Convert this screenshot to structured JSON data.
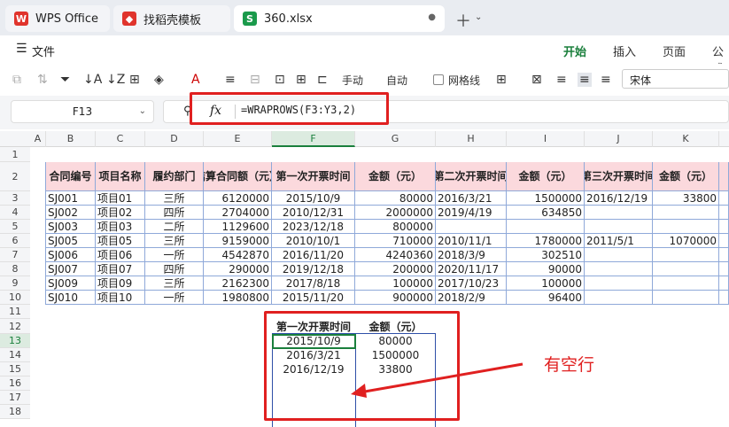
{
  "tabs": [
    {
      "label": "WPS Office",
      "icon": "wps-logo-icon"
    },
    {
      "label": "找稻壳模板",
      "icon": "docer-icon"
    },
    {
      "label": "360.xlsx",
      "icon": "spreadsheet-icon",
      "badge": "S"
    }
  ],
  "menu": {
    "file": "文件",
    "ribbon_tabs": [
      "开始",
      "插入",
      "页面",
      "公式"
    ]
  },
  "toolbar": {
    "manual": "手动",
    "auto": "自动",
    "gridlines": "网格线",
    "font": "宋体"
  },
  "formula_bar": {
    "cell_ref": "F13",
    "fx": "fx",
    "formula": "=WRAPROWS(F3:Y3,2)"
  },
  "columns": [
    "A",
    "B",
    "C",
    "D",
    "E",
    "F",
    "G",
    "H",
    "I",
    "J",
    "K"
  ],
  "rows": [
    "1",
    "2",
    "3",
    "4",
    "5",
    "6",
    "7",
    "8",
    "9",
    "10",
    "11",
    "12",
    "13",
    "14",
    "15",
    "16",
    "17",
    "18"
  ],
  "table_headers": [
    "合同编号",
    "项目名称",
    "履约部门",
    "结算合同额（元）",
    "第一次开票时间",
    "金额（元）",
    "第二次开票时间",
    "金额（元）",
    "第三次开票时间",
    "金额（元）"
  ],
  "table_rows": [
    [
      "SJ001",
      "项目01",
      "三所",
      "6120000",
      "2015/10/9",
      "80000",
      "2016/3/21",
      "1500000",
      "2016/12/19",
      "33800"
    ],
    [
      "SJ002",
      "项目02",
      "四所",
      "2704000",
      "2010/12/31",
      "2000000",
      "2019/4/19",
      "634850",
      "",
      ""
    ],
    [
      "SJ003",
      "项目03",
      "二所",
      "1129600",
      "2023/12/18",
      "800000",
      "",
      "",
      "",
      ""
    ],
    [
      "SJ005",
      "项目05",
      "三所",
      "9159000",
      "2010/10/1",
      "710000",
      "2010/11/1",
      "1780000",
      "2011/5/1",
      "1070000"
    ],
    [
      "SJ006",
      "项目06",
      "一所",
      "4542870",
      "2016/11/20",
      "4240360",
      "2018/3/9",
      "302510",
      "",
      ""
    ],
    [
      "SJ007",
      "项目07",
      "四所",
      "290000",
      "2019/12/18",
      "200000",
      "2020/11/17",
      "90000",
      "",
      ""
    ],
    [
      "SJ009",
      "项目09",
      "三所",
      "2162300",
      "2017/8/18",
      "100000",
      "2017/10/23",
      "100000",
      "",
      ""
    ],
    [
      "SJ010",
      "项目10",
      "一所",
      "1980800",
      "2015/11/20",
      "900000",
      "2018/2/9",
      "96400",
      "",
      ""
    ]
  ],
  "result_headers": [
    "第一次开票时间",
    "金额（元）"
  ],
  "result_rows": [
    [
      "2015/10/9",
      "80000"
    ],
    [
      "2016/3/21",
      "1500000"
    ],
    [
      "2016/12/19",
      "33800"
    ]
  ],
  "annotation": "有空行",
  "colors": {
    "accent": "#1a7f3c",
    "highlight": "#e02020",
    "header_fill": "#fbd9dd"
  }
}
